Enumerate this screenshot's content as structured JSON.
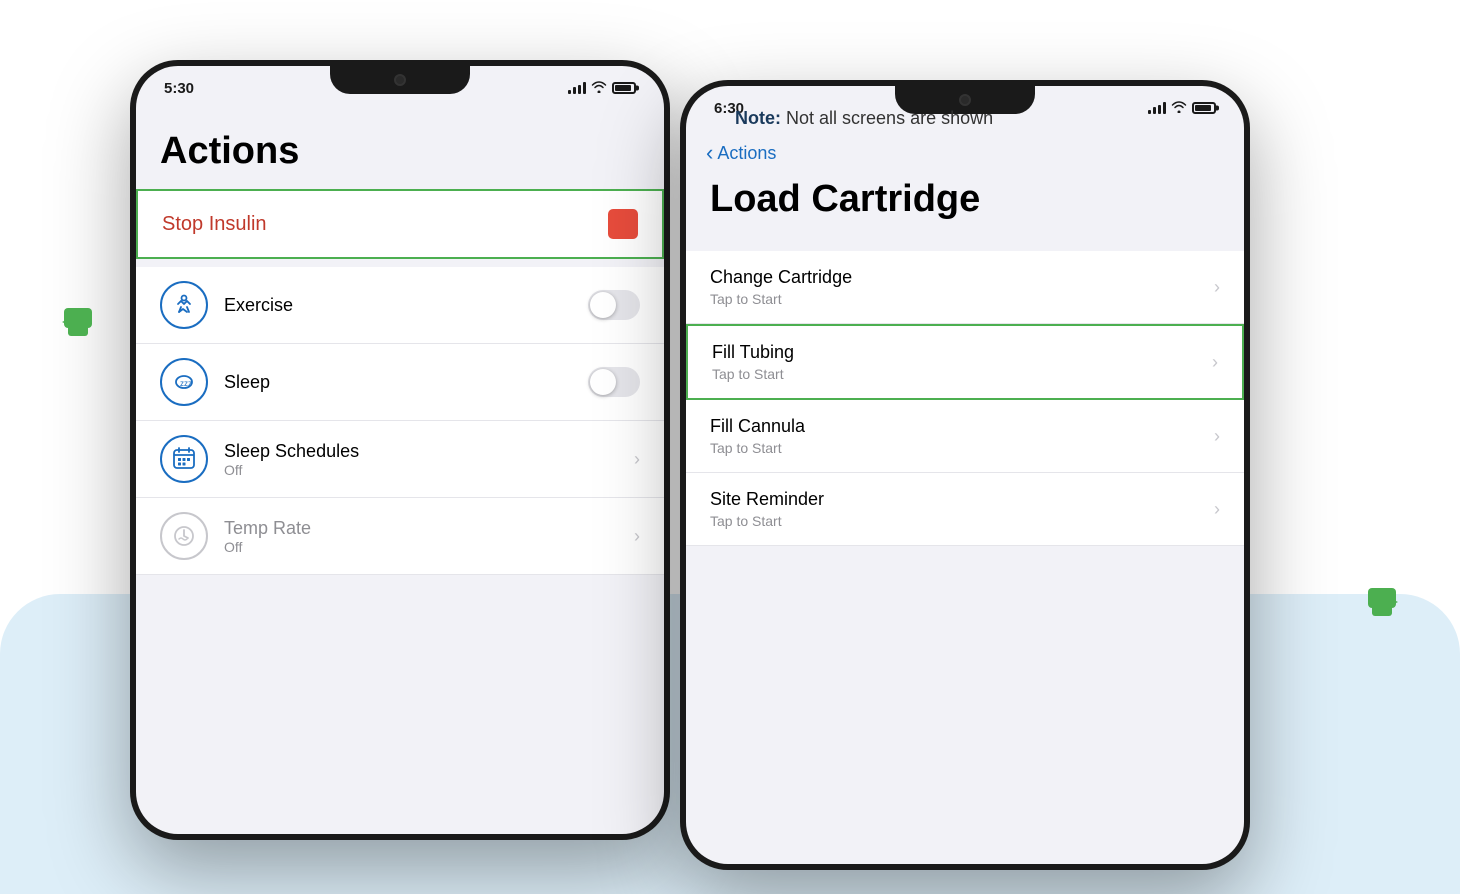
{
  "note": {
    "prefix": "Note:",
    "text": " Not all screens are shown"
  },
  "phone_left": {
    "status": {
      "time": "5:30"
    },
    "title": "Actions",
    "stop_insulin": {
      "label": "Stop Insulin"
    },
    "rows": [
      {
        "id": "exercise",
        "label": "Exercise",
        "sub": "",
        "type": "toggle"
      },
      {
        "id": "sleep",
        "label": "Sleep",
        "sub": "",
        "type": "toggle"
      },
      {
        "id": "sleep-schedules",
        "label": "Sleep Schedules",
        "sub": "Off",
        "type": "chevron"
      },
      {
        "id": "temp-rate",
        "label": "Temp Rate",
        "sub": "Off",
        "type": "chevron",
        "disabled": true
      }
    ]
  },
  "phone_right": {
    "status": {
      "time": "6:30"
    },
    "back_label": "Actions",
    "title": "Load Cartridge",
    "rows": [
      {
        "id": "change-cartridge",
        "label": "Change Cartridge",
        "sub": "Tap to Start",
        "highlighted": false
      },
      {
        "id": "fill-tubing",
        "label": "Fill Tubing",
        "sub": "Tap to Start",
        "highlighted": true
      },
      {
        "id": "fill-cannula",
        "label": "Fill Cannula",
        "sub": "Tap to Start",
        "highlighted": false
      },
      {
        "id": "site-reminder",
        "label": "Site Reminder",
        "sub": "Tap to Start",
        "highlighted": false
      }
    ]
  }
}
